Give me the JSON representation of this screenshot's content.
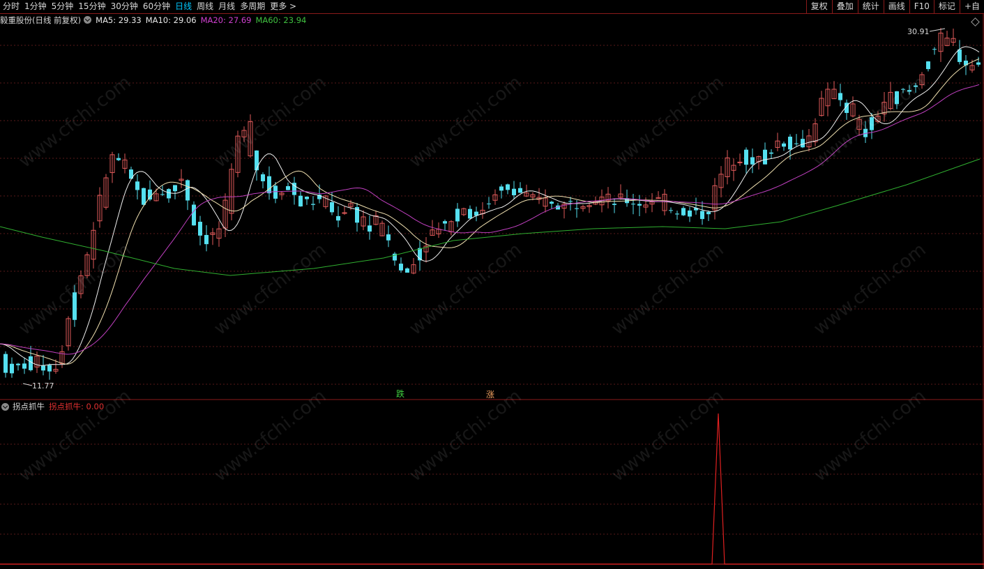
{
  "toolbar": {
    "periods": [
      "分时",
      "1分钟",
      "5分钟",
      "15分钟",
      "30分钟",
      "60分钟",
      "日线",
      "周线",
      "月线",
      "多周期",
      "更多 >"
    ],
    "active": "日线",
    "right_buttons": [
      "复权",
      "叠加",
      "统计",
      "画线",
      "F10",
      "标记",
      "+自"
    ]
  },
  "main_chart": {
    "title": "毅重股份(日线 前复权)",
    "ma": [
      {
        "label": "MA5: 29.33",
        "color": "#e8e8e8"
      },
      {
        "label": "MA10: 29.06",
        "color": "#e8e8e8"
      },
      {
        "label": "MA20: 27.69",
        "color": "#d040d0"
      },
      {
        "label": "MA60: 23.94",
        "color": "#40c040"
      }
    ],
    "high_label": "30.91",
    "low_label": "11.77",
    "marker_drop": "跌",
    "marker_rise": "涨"
  },
  "indicator": {
    "name": "拐点抓牛",
    "value_label": "拐点抓牛: 0.00",
    "value_color": "#e03030"
  },
  "colors": {
    "up": "#e05a5a",
    "down": "#55e0f0",
    "grid": "#5a1a1a",
    "ma5": "#f0f0f0",
    "ma10": "#f0e0b0",
    "ma20": "#c040c0",
    "ma60": "#30b030"
  },
  "watermark": "www.cfchi.com"
}
